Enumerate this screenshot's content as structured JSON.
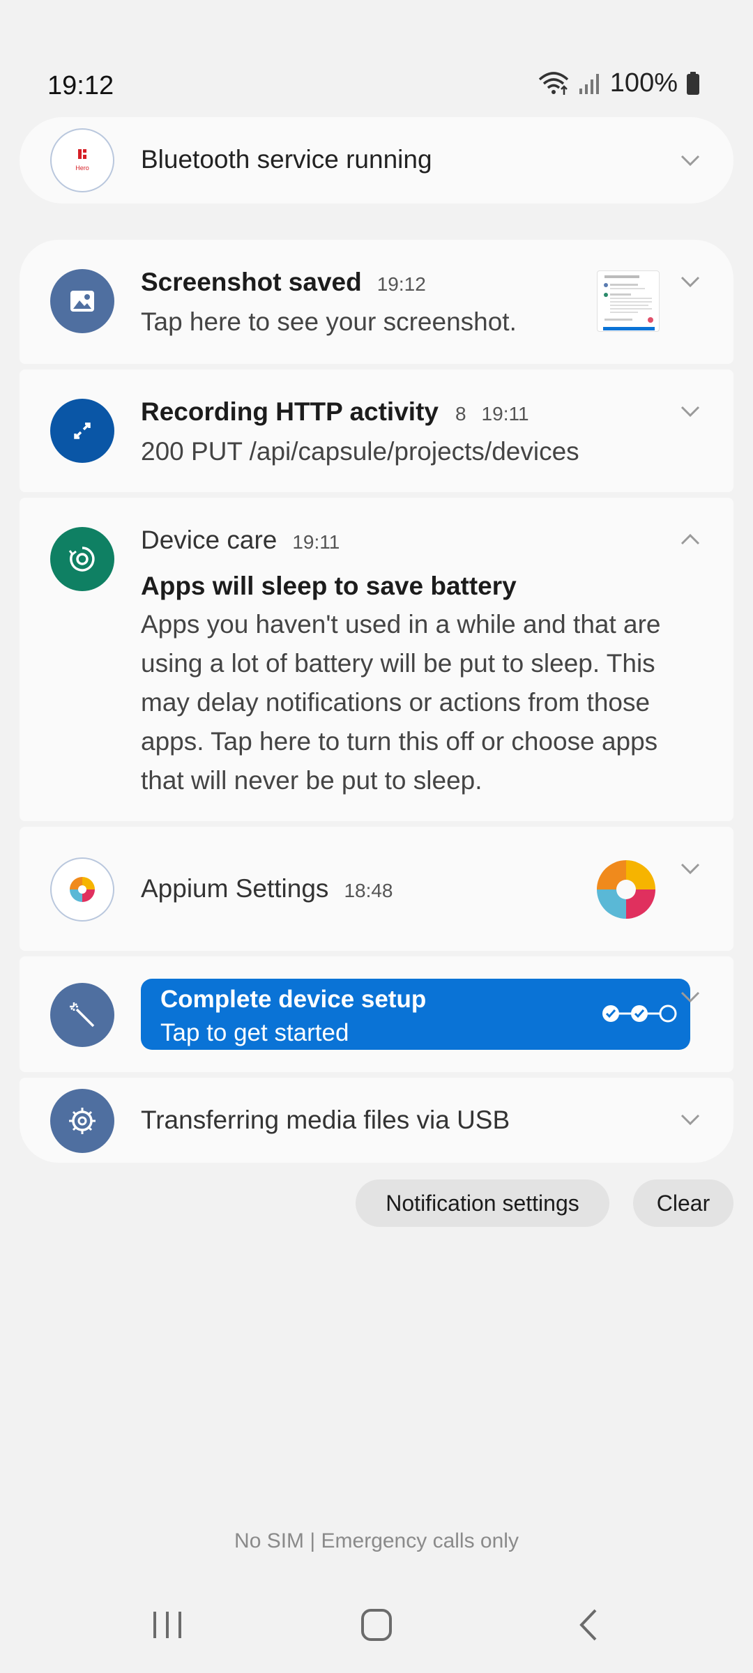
{
  "status_bar": {
    "time": "19:12",
    "battery_text": "100%",
    "icons": [
      "wifi-icon",
      "signal-icon",
      "battery-icon"
    ]
  },
  "notifications": {
    "bluetooth": {
      "title": "Bluetooth service running",
      "app_icon": "hero-logo-icon"
    },
    "screenshot": {
      "title": "Screenshot saved",
      "time": "19:12",
      "text": "Tap here to see your screenshot.",
      "app_icon": "image-icon"
    },
    "http": {
      "title": "Recording HTTP activity",
      "count": "8",
      "time": "19:11",
      "text": "200 PUT /api/capsule/projects/devices",
      "app_icon": "expand-arrows-icon"
    },
    "device_care": {
      "title": "Device care",
      "time": "19:11",
      "heading": "Apps will sleep to save battery",
      "body_lines": [
        "Apps you haven't used in a while and that are",
        "using a lot of battery will be put to sleep. This",
        "may delay notifications or actions from those",
        "apps. Tap here to turn this off or choose apps",
        "that will never be put to sleep."
      ],
      "app_icon": "device-care-icon"
    },
    "appium": {
      "title": "Appium Settings",
      "time": "18:48",
      "app_icon": "appium-icon"
    },
    "setup": {
      "title": "Complete device setup",
      "subtitle": "Tap to get started",
      "app_icon": "magic-wand-icon"
    },
    "usb": {
      "title": "Transferring media files via USB",
      "app_icon": "usb-settings-icon"
    }
  },
  "actions": {
    "settings_label": "Notification settings",
    "clear_label": "Clear"
  },
  "footer": {
    "sim_status": "No SIM | Emergency calls only"
  },
  "colors": {
    "background": "#f2f2f2",
    "card": "#fafafa",
    "icon_blue_grey": "#4f6fa0",
    "icon_blue": "#0a56a6",
    "icon_green": "#0f8063",
    "setup_blue": "#0a73d6"
  }
}
